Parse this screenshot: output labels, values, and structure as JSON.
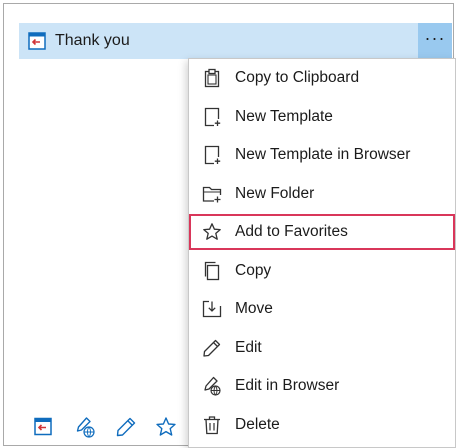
{
  "item": {
    "title": "Thank you",
    "icon": "template-icon",
    "more_label": "···"
  },
  "menu": {
    "items": [
      {
        "label": "Copy to Clipboard",
        "icon": "clipboard-icon"
      },
      {
        "label": "New Template",
        "icon": "new-template-icon"
      },
      {
        "label": "New Template in Browser",
        "icon": "new-template-browser-icon"
      },
      {
        "label": "New Folder",
        "icon": "new-folder-icon"
      },
      {
        "label": "Add to Favorites",
        "icon": "star-icon",
        "highlighted": true
      },
      {
        "label": "Copy",
        "icon": "copy-icon"
      },
      {
        "label": "Move",
        "icon": "move-icon"
      },
      {
        "label": "Edit",
        "icon": "pencil-icon"
      },
      {
        "label": "Edit in Browser",
        "icon": "edit-browser-icon"
      },
      {
        "label": "Delete",
        "icon": "trash-icon"
      }
    ]
  },
  "toolbar": {
    "icons": [
      "insert-template-icon",
      "edit-browser-icon",
      "pencil-icon",
      "star-icon"
    ]
  },
  "colors": {
    "selected_row": "#cce4f7",
    "more_button": "#99c9ef",
    "highlight_border": "#d9365a",
    "accent": "#0f6cbd",
    "template_red": "#d13438"
  }
}
